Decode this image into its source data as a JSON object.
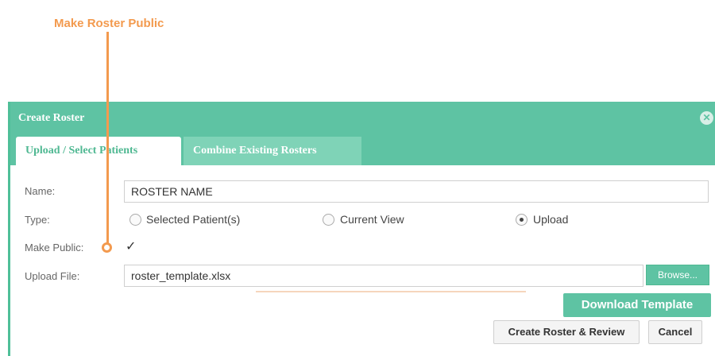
{
  "annotation": {
    "callout_text": "Make Roster Public"
  },
  "dialog": {
    "title": "Create Roster",
    "tabs": [
      {
        "label": "Upload / Select Patients",
        "active": true
      },
      {
        "label": "Combine Existing Rosters",
        "active": false
      }
    ],
    "form": {
      "name_label": "Name:",
      "name_value": "ROSTER NAME",
      "type_label": "Type:",
      "type_options": [
        {
          "label": "Selected Patient(s)",
          "selected": false
        },
        {
          "label": "Current View",
          "selected": false
        },
        {
          "label": "Upload",
          "selected": true
        }
      ],
      "make_public_label": "Make Public:",
      "make_public_checked": true,
      "upload_label": "Upload File:",
      "upload_value": "roster_template.xlsx",
      "browse_label": "Browse...",
      "download_label": "Download Template",
      "create_label": "Create Roster & Review",
      "cancel_label": "Cancel"
    }
  },
  "colors": {
    "accent": "#5ec3a3",
    "callout": "#f39a4e"
  }
}
